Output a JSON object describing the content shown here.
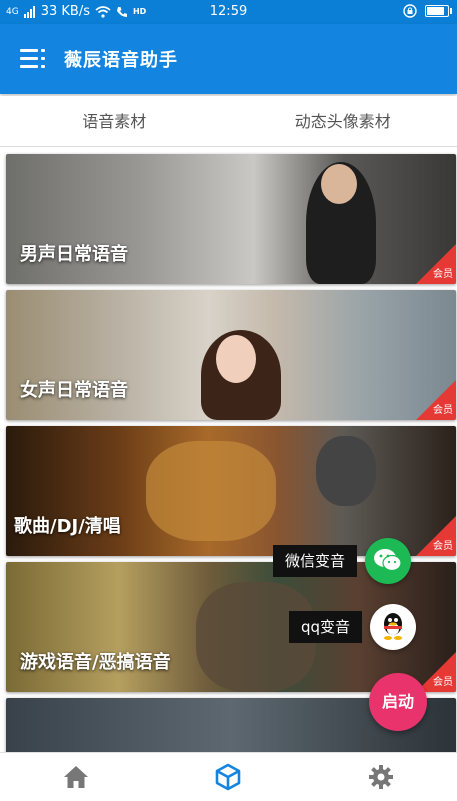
{
  "status_bar": {
    "network": "4G",
    "speed": "33 KB/s",
    "hd": "HD",
    "time": "12:59"
  },
  "app_bar": {
    "title": "薇辰语音助手",
    "icon": "menu-icon"
  },
  "tabs": [
    {
      "label": "语音素材"
    },
    {
      "label": "动态头像素材"
    }
  ],
  "cards": [
    {
      "label": "男声日常语音",
      "badge": "会员"
    },
    {
      "label": "女声日常语音",
      "badge": "会员"
    },
    {
      "label": "歌曲/DJ/清唱",
      "badge": "会员"
    },
    {
      "label": "游戏语音/恶搞语音",
      "badge": "会员"
    }
  ],
  "floating_actions": {
    "wechat": {
      "label": "微信变音",
      "icon": "wechat-icon",
      "color": "#1db954"
    },
    "qq": {
      "label": "qq变音",
      "icon": "qq-penguin-icon"
    },
    "start": {
      "label": "启动",
      "color": "#e8336d"
    }
  },
  "bottom_nav": [
    {
      "icon": "home-icon",
      "color": "#777777"
    },
    {
      "icon": "cube-icon",
      "color": "#1384e0"
    },
    {
      "icon": "gear-icon",
      "color": "#777777"
    }
  ],
  "colors": {
    "primary": "#1384e0",
    "badge": "#e53935"
  }
}
